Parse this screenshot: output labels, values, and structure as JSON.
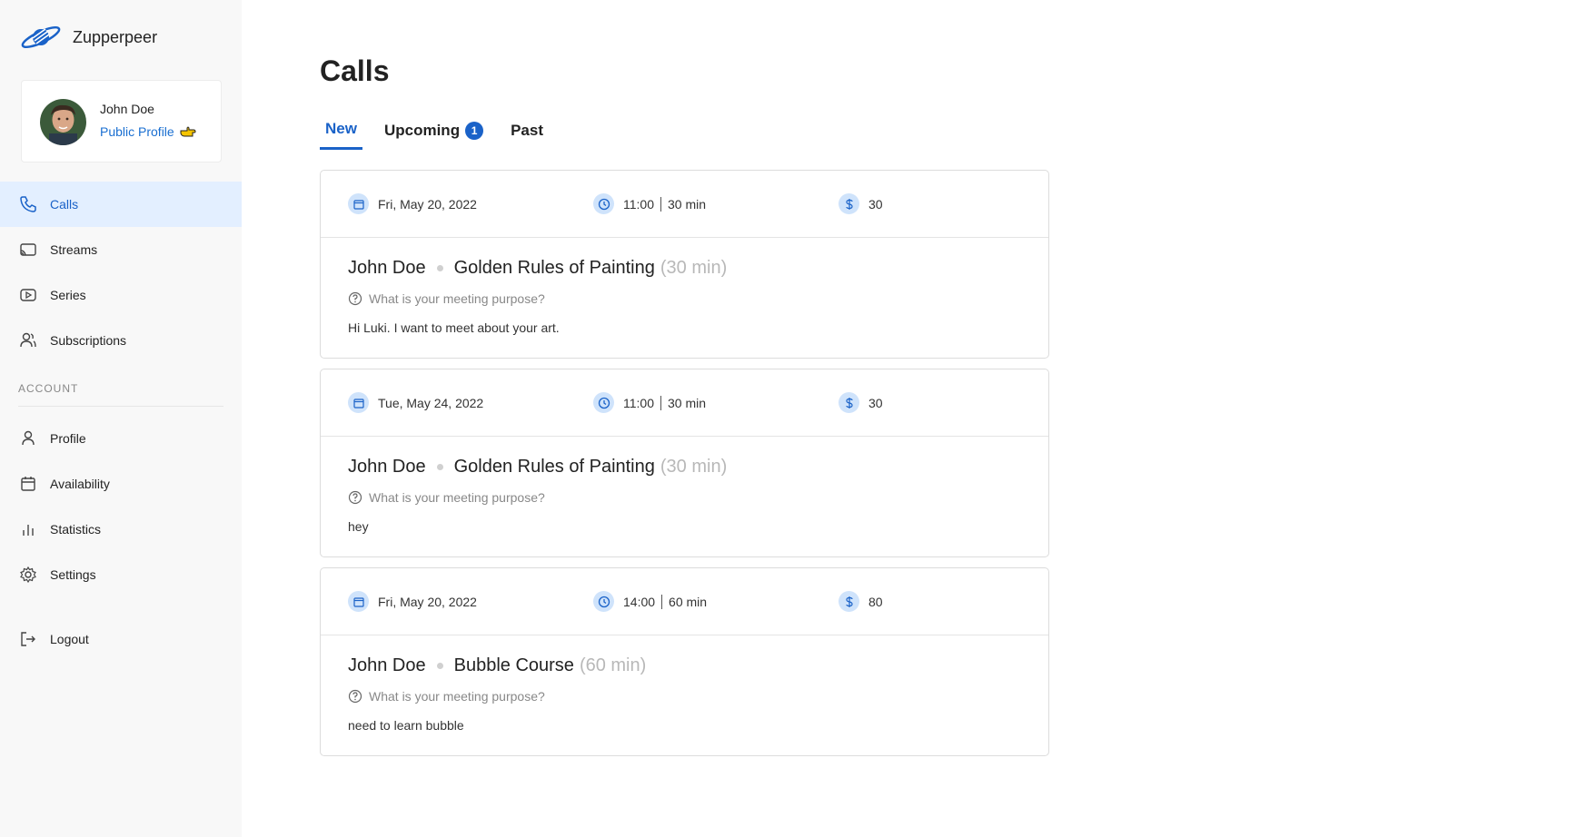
{
  "app": {
    "name": "Zupperpeer"
  },
  "profile": {
    "name": "John Doe",
    "link_label": "Public Profile"
  },
  "nav": {
    "main": [
      {
        "label": "Calls",
        "icon": "phone-icon",
        "active": true
      },
      {
        "label": "Streams",
        "icon": "cast-icon",
        "active": false
      },
      {
        "label": "Series",
        "icon": "play-icon",
        "active": false
      },
      {
        "label": "Subscriptions",
        "icon": "users-icon",
        "active": false
      }
    ],
    "account_label": "ACCOUNT",
    "account": [
      {
        "label": "Profile",
        "icon": "user-icon"
      },
      {
        "label": "Availability",
        "icon": "calendar-icon"
      },
      {
        "label": "Statistics",
        "icon": "bar-chart-icon"
      },
      {
        "label": "Settings",
        "icon": "gear-icon"
      }
    ],
    "logout": {
      "label": "Logout",
      "icon": "logout-icon"
    }
  },
  "page": {
    "title": "Calls",
    "tabs": [
      {
        "label": "New",
        "active": true
      },
      {
        "label": "Upcoming",
        "badge": "1"
      },
      {
        "label": "Past"
      }
    ]
  },
  "calls": [
    {
      "date": "Fri, May 20, 2022",
      "time": "11:00",
      "length": "30 min",
      "price": "30",
      "person": "John Doe",
      "course": "Golden Rules of Painting",
      "duration": "(30 min)",
      "question": "What is your meeting purpose?",
      "message": "Hi Luki. I want to meet about your art."
    },
    {
      "date": "Tue, May 24, 2022",
      "time": "11:00",
      "length": "30 min",
      "price": "30",
      "person": "John Doe",
      "course": "Golden Rules of Painting",
      "duration": "(30 min)",
      "question": "What is your meeting purpose?",
      "message": "hey"
    },
    {
      "date": "Fri, May 20, 2022",
      "time": "14:00",
      "length": "60 min",
      "price": "80",
      "person": "John Doe",
      "course": "Bubble Course",
      "duration": "(60 min)",
      "question": "What is your meeting purpose?",
      "message": "need to learn bubble"
    }
  ],
  "colors": {
    "accent": "#1a62c8",
    "active_bg": "#e3efff",
    "icon_bg": "#cfe3fb"
  }
}
